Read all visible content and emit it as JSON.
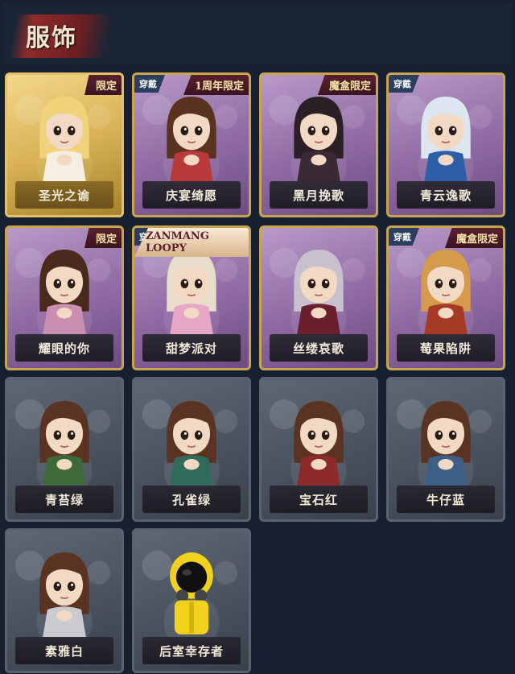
{
  "header": {
    "title": "服饰"
  },
  "items": [
    {
      "label": "圣光之谕",
      "tier": "gold",
      "badge_tr": "限定",
      "badge_tl": "",
      "hair": "#f0d27a",
      "outfit": "#f4efe0",
      "icon": "golden-character-icon"
    },
    {
      "label": "庆宴绮愿",
      "tier": "purple",
      "badge_tr": "1周年限定",
      "badge_tl": "穿戴",
      "hair": "#5a3220",
      "outfit": "#b83a3a",
      "icon": "cake-character-icon"
    },
    {
      "label": "黑月挽歌",
      "tier": "purple",
      "badge_tr": "魔盒限定",
      "badge_tl": "",
      "hair": "#2a2026",
      "outfit": "#3a2a36",
      "icon": "dark-moon-character-icon"
    },
    {
      "label": "青云逸歌",
      "tier": "purple",
      "badge_tr": "",
      "badge_tl": "穿戴",
      "hair": "#dde6f0",
      "outfit": "#2d5fa8",
      "icon": "blue-cloud-character-icon"
    },
    {
      "label": "耀眼的你",
      "tier": "purple",
      "badge_tr": "限定",
      "badge_tl": "",
      "hair": "#4b2a1e",
      "outfit": "#c98fb0",
      "icon": "cowboy-hat-character-icon"
    },
    {
      "label": "甜梦派对",
      "tier": "purple",
      "badge_tr": "ZANMANG LOOPY",
      "badge_tl": "穿戴",
      "hair": "#e8dccb",
      "outfit": "#e6a6c6",
      "icon": "party-character-icon"
    },
    {
      "label": "丝缕哀歌",
      "tier": "purple",
      "badge_tr": "",
      "badge_tl": "",
      "hair": "#c8c0cc",
      "outfit": "#6b1e2c",
      "icon": "gothic-character-icon"
    },
    {
      "label": "莓果陷阱",
      "tier": "purple",
      "badge_tr": "魔盒限定",
      "badge_tl": "穿戴",
      "hair": "#d59a4a",
      "outfit": "#a63a24",
      "icon": "berry-character-icon"
    },
    {
      "label": "青苔绿",
      "tier": "gray",
      "badge_tr": "",
      "badge_tl": "",
      "hair": "#5b3322",
      "outfit": "#3e6a3a",
      "icon": "moss-green-character-icon"
    },
    {
      "label": "孔雀绿",
      "tier": "gray",
      "badge_tr": "",
      "badge_tl": "",
      "hair": "#5b3322",
      "outfit": "#2f6a5a",
      "icon": "peacock-green-character-icon"
    },
    {
      "label": "宝石红",
      "tier": "gray",
      "badge_tr": "",
      "badge_tl": "",
      "hair": "#5b3322",
      "outfit": "#8e2a2a",
      "icon": "gem-red-character-icon"
    },
    {
      "label": "牛仔蓝",
      "tier": "gray",
      "badge_tr": "",
      "badge_tl": "",
      "hair": "#5b3322",
      "outfit": "#3d5f86",
      "icon": "denim-blue-character-icon"
    },
    {
      "label": "素雅白",
      "tier": "gray",
      "badge_tr": "",
      "badge_tl": "",
      "hair": "#5b3322",
      "outfit": "#c9cbcf",
      "icon": "plain-white-character-icon"
    },
    {
      "label": "后室幸存者",
      "tier": "gray",
      "badge_tr": "",
      "badge_tl": "",
      "hair": "#1a1a1a",
      "outfit": "#f2d11c",
      "icon": "hazmat-survivor-icon"
    }
  ]
}
